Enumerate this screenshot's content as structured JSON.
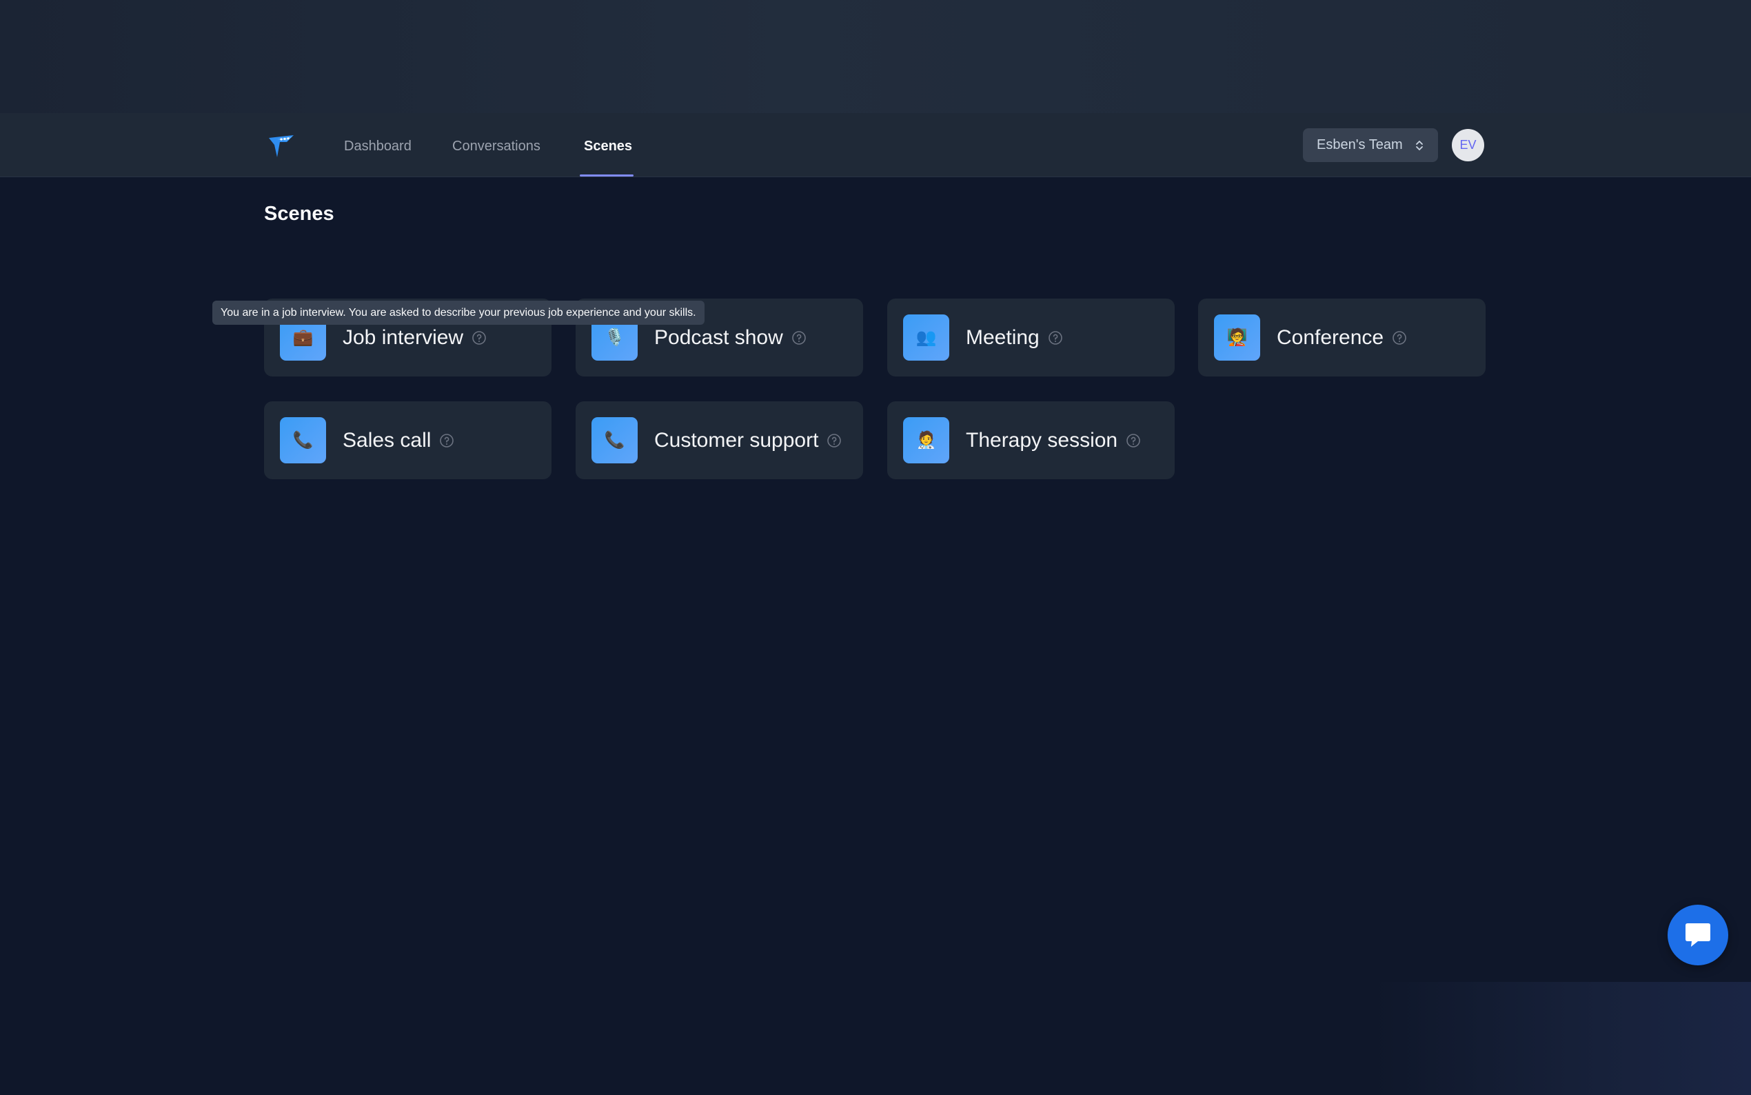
{
  "nav": {
    "logo_icon": "app-logo-icon",
    "links": [
      {
        "label": "Dashboard",
        "active": false
      },
      {
        "label": "Conversations",
        "active": false
      },
      {
        "label": "Scenes",
        "active": true
      }
    ],
    "team_selector": {
      "label": "Esben's Team",
      "icon": "chevron-up-down-icon"
    },
    "avatar_initials": "EV"
  },
  "page": {
    "title": "Scenes"
  },
  "tooltip": {
    "text": "You are in a job interview. You are asked to describe your previous job experience and your skills."
  },
  "scenes": [
    {
      "label": "Job interview",
      "emoji": "💼",
      "icon": "briefcase-icon"
    },
    {
      "label": "Podcast show",
      "emoji": "🎙️",
      "icon": "microphone-icon"
    },
    {
      "label": "Meeting",
      "emoji": "👥",
      "icon": "people-icon"
    },
    {
      "label": "Conference",
      "emoji": "🧑‍🏫",
      "icon": "presenter-icon"
    },
    {
      "label": "Sales call",
      "emoji": "📞",
      "icon": "phone-icon"
    },
    {
      "label": "Customer support",
      "emoji": "📞",
      "icon": "phone-icon"
    },
    {
      "label": "Therapy session",
      "emoji": "🧑‍⚕️",
      "icon": "health-worker-icon"
    }
  ],
  "chat_widget": {
    "icon": "chat-bubble-icon"
  },
  "colors": {
    "background": "#0f172a",
    "nav_background": "#1f2937",
    "card_background": "#1f2937",
    "accent": "#818cf8",
    "icon_gradient_start": "#3b9cf5",
    "chat_button": "#1d6fe8"
  }
}
